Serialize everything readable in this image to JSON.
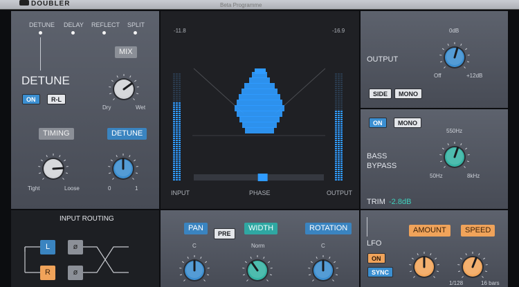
{
  "header": {
    "logo_text": "DOUBLER",
    "preset": "Beta Programme"
  },
  "detune_panel": {
    "modes": [
      "DETUNE",
      "DELAY",
      "REFLECT",
      "SPLIT"
    ],
    "title": "DETUNE",
    "on_label": "ON",
    "rl_label": "R-L",
    "mix": {
      "label": "MIX",
      "min_label": "Dry",
      "max_label": "Wet",
      "value": 0.7
    },
    "timing": {
      "label": "TIMING",
      "min_label": "Tight",
      "max_label": "Loose",
      "value": 0.82
    },
    "detune": {
      "label": "DETUNE",
      "min_label": "0",
      "max_label": "1",
      "value": 0.5
    }
  },
  "visualizer": {
    "left_peak": "-11.8",
    "right_peak": "-16.9",
    "input_label": "INPUT",
    "phase_label": "PHASE",
    "output_label": "OUTPUT",
    "input_level": 0.72,
    "output_level": 0.64,
    "phase_position": 0.53
  },
  "output_panel": {
    "title": "OUTPUT",
    "top_label": "0dB",
    "min_label": "Off",
    "max_label": "+12dB",
    "value": 0.56,
    "side_label": "SIDE",
    "mono_label": "MONO"
  },
  "bass_panel": {
    "on_label": "ON",
    "mono_label": "MONO",
    "title_line1": "BASS",
    "title_line2": "BYPASS",
    "top_label": "550Hz",
    "min_label": "50Hz",
    "max_label": "8kHz",
    "value": 0.57,
    "trim_label": "TRIM",
    "trim_value": "-2.8dB"
  },
  "routing_panel": {
    "title": "INPUT ROUTING",
    "left_label": "L",
    "right_label": "R",
    "phase_symbol": "ø"
  },
  "stereo_panel": {
    "pan_label": "PAN",
    "pre_label": "PRE",
    "width_label": "WIDTH",
    "rotation_label": "ROTATION",
    "pan_top": "C",
    "width_top": "Norm",
    "rotation_top": "C",
    "pan_value": 0.5,
    "width_value": 0.37,
    "rotation_value": 0.5
  },
  "lfo_panel": {
    "title": "LFO",
    "on_label": "ON",
    "sync_label": "SYNC",
    "amount_label": "AMOUNT",
    "speed_label": "SPEED",
    "speed_min": "1/128",
    "speed_max": "16 bars",
    "amount_value": 0.5,
    "speed_value": 0.58
  },
  "colors": {
    "blue_knob": "#3d8fd0",
    "teal_knob": "#36b3a3",
    "orange_knob": "#f2a65c",
    "grey_knob": "#d2d4d8",
    "meter_blue": "#2f9bff"
  }
}
